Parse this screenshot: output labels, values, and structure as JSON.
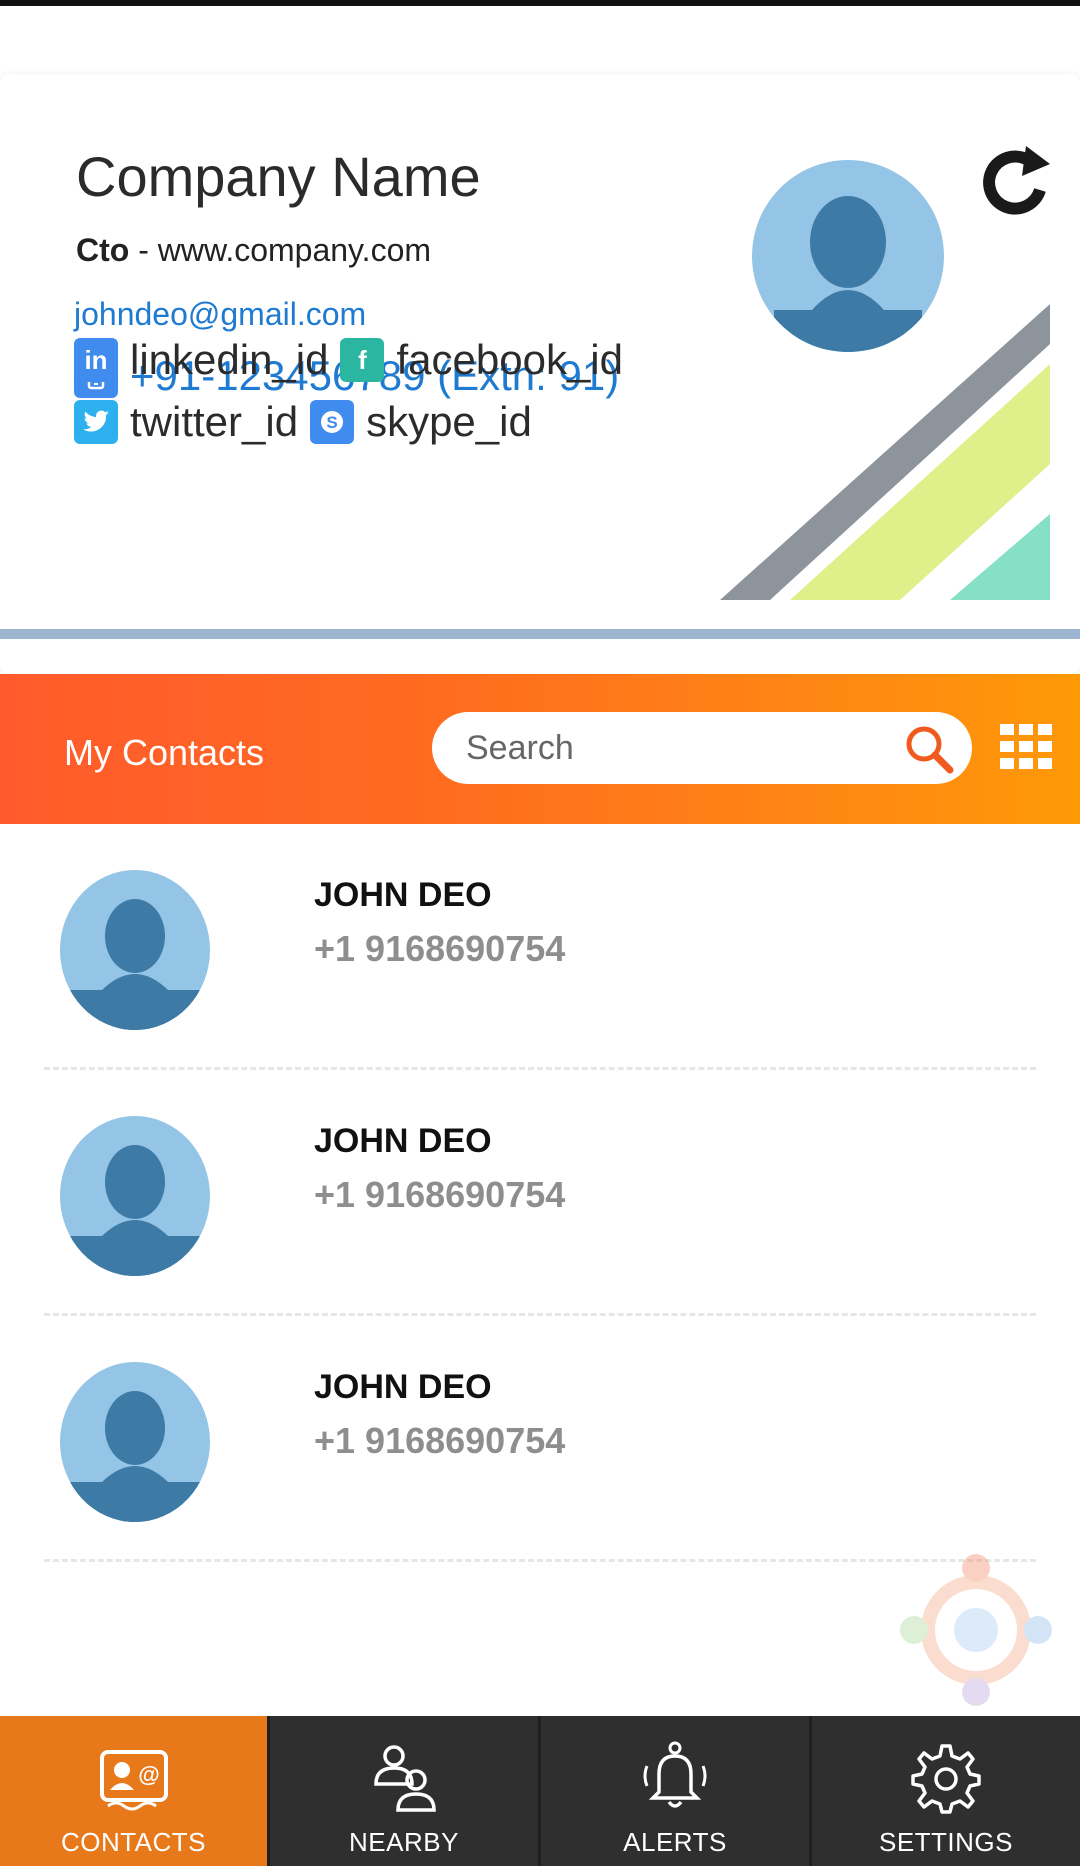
{
  "profile": {
    "company_name": "Company Name",
    "role": "Cto",
    "separator": " - ",
    "website": "www.company.com",
    "email": "johndeo@gmail.com",
    "phone": "+91-123456789 (Extn: 91)",
    "linkedin": "linkedin_id",
    "facebook": "facebook_id",
    "twitter": "twitter_id",
    "skype": "skype_id"
  },
  "header": {
    "title": "My Contacts",
    "search_placeholder": "Search"
  },
  "contacts": [
    {
      "name": "JOHN DEO",
      "phone": "+1 9168690754"
    },
    {
      "name": "JOHN DEO",
      "phone": "+1 9168690754"
    },
    {
      "name": "JOHN DEO",
      "phone": "+1 9168690754"
    }
  ],
  "nav": {
    "items": [
      {
        "label": "CONTACTS",
        "icon": "contact-card-icon",
        "active": true
      },
      {
        "label": "NEARBY",
        "icon": "nearby-people-icon",
        "active": false
      },
      {
        "label": "ALERTS",
        "icon": "bell-icon",
        "active": false
      },
      {
        "label": "SETTINGS",
        "icon": "gear-icon",
        "active": false
      }
    ]
  },
  "colors": {
    "accent_orange": "#e8791b",
    "gradient_start": "#ff5a2c",
    "gradient_end": "#ff9906",
    "link_blue": "#1f7ad1",
    "nav_dark": "#2f2f2f",
    "avatar_light": "#94c5e7",
    "avatar_dark": "#3d7aa5",
    "linkedin": "#3f8bee",
    "facebook": "#2ab6a1",
    "twitter": "#2eb0ef",
    "skype": "#3f8bee"
  }
}
